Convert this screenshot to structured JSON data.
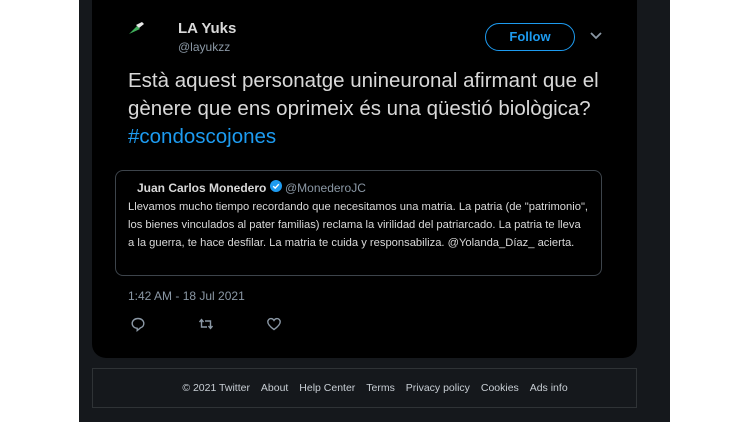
{
  "tweet": {
    "display_name": "LA Yuks",
    "handle": "@layukzz",
    "follow_label": "Follow",
    "text_main": "Està aquest personatge unineuronal afirmant que el gènere que ens oprimeix és una qüestió biològica? ",
    "hashtag": "#condoscojones",
    "timestamp": "1:42 AM - 18 Jul 2021"
  },
  "quote": {
    "name": "Juan Carlos Monedero",
    "handle": "@MonederoJC",
    "text": "Llevamos mucho tiempo recordando que necesitamos una matria. La patria (de \"patrimonio\", los bienes vinculados al pater familias) reclama la virilidad del patriarcado. La patria te lleva a la guerra, te hace desfilar. La matria te cuida y responsabiliza. @Yolanda_Díaz_ acierta."
  },
  "actions": [
    "reply-icon",
    "retweet-icon",
    "like-icon"
  ],
  "footer": {
    "copyright": "© 2021 Twitter",
    "links": [
      "About",
      "Help Center",
      "Terms",
      "Privacy policy",
      "Cookies",
      "Ads info"
    ]
  },
  "colors": {
    "accent": "#1d9bf0",
    "card_bg": "#000000",
    "page_bg": "#15181c"
  }
}
